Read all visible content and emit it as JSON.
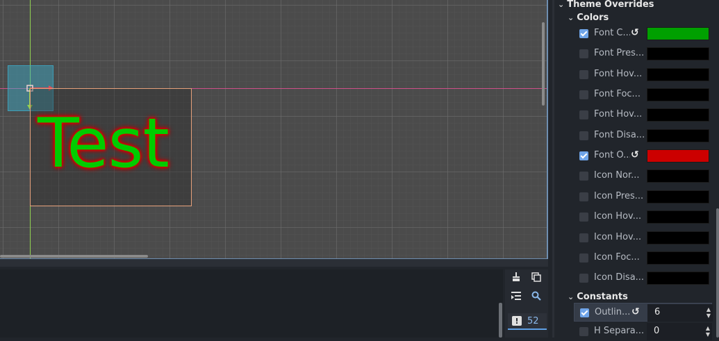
{
  "viewport": {
    "label_text": "Test",
    "label_font_color": "#00cc00",
    "label_outline_color": "#e00000"
  },
  "output": {
    "error_count": "52"
  },
  "inspector": {
    "theme_overrides_label": "Theme Overrides",
    "colors_label": "Colors",
    "constants_label": "Constants",
    "color_rows": [
      {
        "label": "Font C...",
        "checked": true,
        "revert": true,
        "color": "#00a000"
      },
      {
        "label": "Font Pres...",
        "checked": false,
        "revert": false,
        "color": "#000000"
      },
      {
        "label": "Font Hov...",
        "checked": false,
        "revert": false,
        "color": "#000000"
      },
      {
        "label": "Font Foc...",
        "checked": false,
        "revert": false,
        "color": "#000000"
      },
      {
        "label": "Font Hov...",
        "checked": false,
        "revert": false,
        "color": "#000000"
      },
      {
        "label": "Font Disa...",
        "checked": false,
        "revert": false,
        "color": "#000000"
      },
      {
        "label": "Font O...",
        "checked": true,
        "revert": true,
        "color": "#cc0000"
      },
      {
        "label": "Icon Nor...",
        "checked": false,
        "revert": false,
        "color": "#000000"
      },
      {
        "label": "Icon Pres...",
        "checked": false,
        "revert": false,
        "color": "#000000"
      },
      {
        "label": "Icon Hov...",
        "checked": false,
        "revert": false,
        "color": "#000000"
      },
      {
        "label": "Icon Hov...",
        "checked": false,
        "revert": false,
        "color": "#000000"
      },
      {
        "label": "Icon Foc...",
        "checked": false,
        "revert": false,
        "color": "#000000"
      },
      {
        "label": "Icon Disa...",
        "checked": false,
        "revert": false,
        "color": "#000000"
      }
    ],
    "constant_rows": [
      {
        "label": "Outlin...",
        "checked": true,
        "revert": true,
        "value": "6"
      },
      {
        "label": "H Separa...",
        "checked": false,
        "revert": false,
        "value": "0"
      }
    ]
  }
}
